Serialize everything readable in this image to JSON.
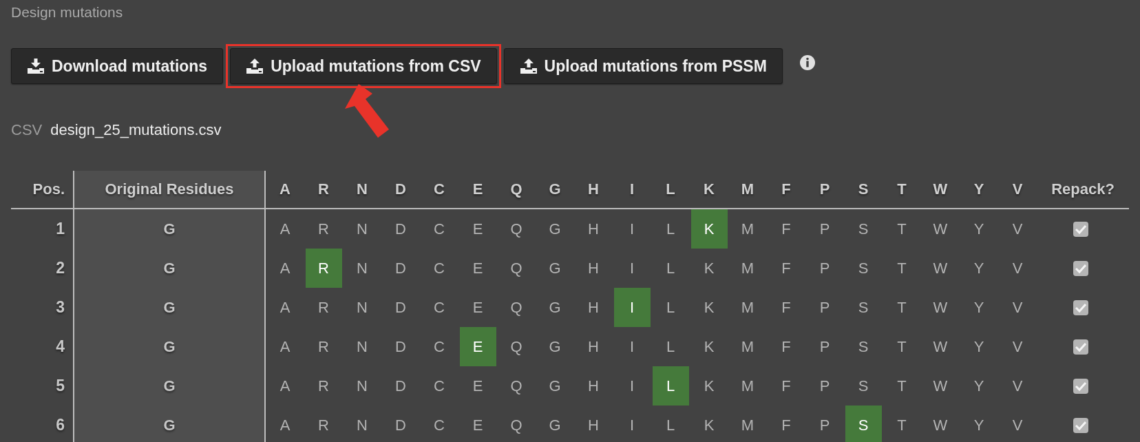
{
  "section_title": "Design mutations",
  "buttons": [
    {
      "label": "Download mutations",
      "kind": "download",
      "highlighted": false
    },
    {
      "label": "Upload mutations from CSV",
      "kind": "upload",
      "highlighted": true
    },
    {
      "label": "Upload mutations from PSSM",
      "kind": "upload",
      "highlighted": false
    }
  ],
  "file": {
    "label": "CSV",
    "name": "design_25_mutations.csv"
  },
  "table": {
    "columns": [
      "Pos.",
      "Original Residues",
      "A",
      "R",
      "N",
      "D",
      "C",
      "E",
      "Q",
      "G",
      "H",
      "I",
      "L",
      "K",
      "M",
      "F",
      "P",
      "S",
      "T",
      "W",
      "Y",
      "V",
      "Repack?"
    ],
    "rows": [
      {
        "cells": [
          {
            "kind": "pos",
            "text": "1"
          },
          {
            "kind": "original",
            "text": "G"
          },
          {
            "kind": "residue",
            "text": "A",
            "selected": false
          },
          {
            "kind": "residue",
            "text": "R",
            "selected": false
          },
          {
            "kind": "residue",
            "text": "N",
            "selected": false
          },
          {
            "kind": "residue",
            "text": "D",
            "selected": false
          },
          {
            "kind": "residue",
            "text": "C",
            "selected": false
          },
          {
            "kind": "residue",
            "text": "E",
            "selected": false
          },
          {
            "kind": "residue",
            "text": "Q",
            "selected": false
          },
          {
            "kind": "residue",
            "text": "G",
            "selected": false
          },
          {
            "kind": "residue",
            "text": "H",
            "selected": false
          },
          {
            "kind": "residue",
            "text": "I",
            "selected": false
          },
          {
            "kind": "residue",
            "text": "L",
            "selected": false
          },
          {
            "kind": "residue",
            "text": "K",
            "selected": true
          },
          {
            "kind": "residue",
            "text": "M",
            "selected": false
          },
          {
            "kind": "residue",
            "text": "F",
            "selected": false
          },
          {
            "kind": "residue",
            "text": "P",
            "selected": false
          },
          {
            "kind": "residue",
            "text": "S",
            "selected": false
          },
          {
            "kind": "residue",
            "text": "T",
            "selected": false
          },
          {
            "kind": "residue",
            "text": "W",
            "selected": false
          },
          {
            "kind": "residue",
            "text": "Y",
            "selected": false
          },
          {
            "kind": "residue",
            "text": "V",
            "selected": false
          },
          {
            "kind": "checkbox",
            "checked": true
          }
        ]
      },
      {
        "cells": [
          {
            "kind": "pos",
            "text": "2"
          },
          {
            "kind": "original",
            "text": "G"
          },
          {
            "kind": "residue",
            "text": "A",
            "selected": false
          },
          {
            "kind": "residue",
            "text": "R",
            "selected": true
          },
          {
            "kind": "residue",
            "text": "N",
            "selected": false
          },
          {
            "kind": "residue",
            "text": "D",
            "selected": false
          },
          {
            "kind": "residue",
            "text": "C",
            "selected": false
          },
          {
            "kind": "residue",
            "text": "E",
            "selected": false
          },
          {
            "kind": "residue",
            "text": "Q",
            "selected": false
          },
          {
            "kind": "residue",
            "text": "G",
            "selected": false
          },
          {
            "kind": "residue",
            "text": "H",
            "selected": false
          },
          {
            "kind": "residue",
            "text": "I",
            "selected": false
          },
          {
            "kind": "residue",
            "text": "L",
            "selected": false
          },
          {
            "kind": "residue",
            "text": "K",
            "selected": false
          },
          {
            "kind": "residue",
            "text": "M",
            "selected": false
          },
          {
            "kind": "residue",
            "text": "F",
            "selected": false
          },
          {
            "kind": "residue",
            "text": "P",
            "selected": false
          },
          {
            "kind": "residue",
            "text": "S",
            "selected": false
          },
          {
            "kind": "residue",
            "text": "T",
            "selected": false
          },
          {
            "kind": "residue",
            "text": "W",
            "selected": false
          },
          {
            "kind": "residue",
            "text": "Y",
            "selected": false
          },
          {
            "kind": "residue",
            "text": "V",
            "selected": false
          },
          {
            "kind": "checkbox",
            "checked": true
          }
        ]
      },
      {
        "cells": [
          {
            "kind": "pos",
            "text": "3"
          },
          {
            "kind": "original",
            "text": "G"
          },
          {
            "kind": "residue",
            "text": "A",
            "selected": false
          },
          {
            "kind": "residue",
            "text": "R",
            "selected": false
          },
          {
            "kind": "residue",
            "text": "N",
            "selected": false
          },
          {
            "kind": "residue",
            "text": "D",
            "selected": false
          },
          {
            "kind": "residue",
            "text": "C",
            "selected": false
          },
          {
            "kind": "residue",
            "text": "E",
            "selected": false
          },
          {
            "kind": "residue",
            "text": "Q",
            "selected": false
          },
          {
            "kind": "residue",
            "text": "G",
            "selected": false
          },
          {
            "kind": "residue",
            "text": "H",
            "selected": false
          },
          {
            "kind": "residue",
            "text": "I",
            "selected": true
          },
          {
            "kind": "residue",
            "text": "L",
            "selected": false
          },
          {
            "kind": "residue",
            "text": "K",
            "selected": false
          },
          {
            "kind": "residue",
            "text": "M",
            "selected": false
          },
          {
            "kind": "residue",
            "text": "F",
            "selected": false
          },
          {
            "kind": "residue",
            "text": "P",
            "selected": false
          },
          {
            "kind": "residue",
            "text": "S",
            "selected": false
          },
          {
            "kind": "residue",
            "text": "T",
            "selected": false
          },
          {
            "kind": "residue",
            "text": "W",
            "selected": false
          },
          {
            "kind": "residue",
            "text": "Y",
            "selected": false
          },
          {
            "kind": "residue",
            "text": "V",
            "selected": false
          },
          {
            "kind": "checkbox",
            "checked": true
          }
        ]
      },
      {
        "cells": [
          {
            "kind": "pos",
            "text": "4"
          },
          {
            "kind": "original",
            "text": "G"
          },
          {
            "kind": "residue",
            "text": "A",
            "selected": false
          },
          {
            "kind": "residue",
            "text": "R",
            "selected": false
          },
          {
            "kind": "residue",
            "text": "N",
            "selected": false
          },
          {
            "kind": "residue",
            "text": "D",
            "selected": false
          },
          {
            "kind": "residue",
            "text": "C",
            "selected": false
          },
          {
            "kind": "residue",
            "text": "E",
            "selected": true
          },
          {
            "kind": "residue",
            "text": "Q",
            "selected": false
          },
          {
            "kind": "residue",
            "text": "G",
            "selected": false
          },
          {
            "kind": "residue",
            "text": "H",
            "selected": false
          },
          {
            "kind": "residue",
            "text": "I",
            "selected": false
          },
          {
            "kind": "residue",
            "text": "L",
            "selected": false
          },
          {
            "kind": "residue",
            "text": "K",
            "selected": false
          },
          {
            "kind": "residue",
            "text": "M",
            "selected": false
          },
          {
            "kind": "residue",
            "text": "F",
            "selected": false
          },
          {
            "kind": "residue",
            "text": "P",
            "selected": false
          },
          {
            "kind": "residue",
            "text": "S",
            "selected": false
          },
          {
            "kind": "residue",
            "text": "T",
            "selected": false
          },
          {
            "kind": "residue",
            "text": "W",
            "selected": false
          },
          {
            "kind": "residue",
            "text": "Y",
            "selected": false
          },
          {
            "kind": "residue",
            "text": "V",
            "selected": false
          },
          {
            "kind": "checkbox",
            "checked": true
          }
        ]
      },
      {
        "cells": [
          {
            "kind": "pos",
            "text": "5"
          },
          {
            "kind": "original",
            "text": "G"
          },
          {
            "kind": "residue",
            "text": "A",
            "selected": false
          },
          {
            "kind": "residue",
            "text": "R",
            "selected": false
          },
          {
            "kind": "residue",
            "text": "N",
            "selected": false
          },
          {
            "kind": "residue",
            "text": "D",
            "selected": false
          },
          {
            "kind": "residue",
            "text": "C",
            "selected": false
          },
          {
            "kind": "residue",
            "text": "E",
            "selected": false
          },
          {
            "kind": "residue",
            "text": "Q",
            "selected": false
          },
          {
            "kind": "residue",
            "text": "G",
            "selected": false
          },
          {
            "kind": "residue",
            "text": "H",
            "selected": false
          },
          {
            "kind": "residue",
            "text": "I",
            "selected": false
          },
          {
            "kind": "residue",
            "text": "L",
            "selected": true
          },
          {
            "kind": "residue",
            "text": "K",
            "selected": false
          },
          {
            "kind": "residue",
            "text": "M",
            "selected": false
          },
          {
            "kind": "residue",
            "text": "F",
            "selected": false
          },
          {
            "kind": "residue",
            "text": "P",
            "selected": false
          },
          {
            "kind": "residue",
            "text": "S",
            "selected": false
          },
          {
            "kind": "residue",
            "text": "T",
            "selected": false
          },
          {
            "kind": "residue",
            "text": "W",
            "selected": false
          },
          {
            "kind": "residue",
            "text": "Y",
            "selected": false
          },
          {
            "kind": "residue",
            "text": "V",
            "selected": false
          },
          {
            "kind": "checkbox",
            "checked": true
          }
        ]
      },
      {
        "cells": [
          {
            "kind": "pos",
            "text": "6"
          },
          {
            "kind": "original",
            "text": "G"
          },
          {
            "kind": "residue",
            "text": "A",
            "selected": false
          },
          {
            "kind": "residue",
            "text": "R",
            "selected": false
          },
          {
            "kind": "residue",
            "text": "N",
            "selected": false
          },
          {
            "kind": "residue",
            "text": "D",
            "selected": false
          },
          {
            "kind": "residue",
            "text": "C",
            "selected": false
          },
          {
            "kind": "residue",
            "text": "E",
            "selected": false
          },
          {
            "kind": "residue",
            "text": "Q",
            "selected": false
          },
          {
            "kind": "residue",
            "text": "G",
            "selected": false
          },
          {
            "kind": "residue",
            "text": "H",
            "selected": false
          },
          {
            "kind": "residue",
            "text": "I",
            "selected": false
          },
          {
            "kind": "residue",
            "text": "L",
            "selected": false
          },
          {
            "kind": "residue",
            "text": "K",
            "selected": false
          },
          {
            "kind": "residue",
            "text": "M",
            "selected": false
          },
          {
            "kind": "residue",
            "text": "F",
            "selected": false
          },
          {
            "kind": "residue",
            "text": "P",
            "selected": false
          },
          {
            "kind": "residue",
            "text": "S",
            "selected": true
          },
          {
            "kind": "residue",
            "text": "T",
            "selected": false
          },
          {
            "kind": "residue",
            "text": "W",
            "selected": false
          },
          {
            "kind": "residue",
            "text": "Y",
            "selected": false
          },
          {
            "kind": "residue",
            "text": "V",
            "selected": false
          },
          {
            "kind": "checkbox",
            "checked": true
          }
        ]
      }
    ]
  }
}
